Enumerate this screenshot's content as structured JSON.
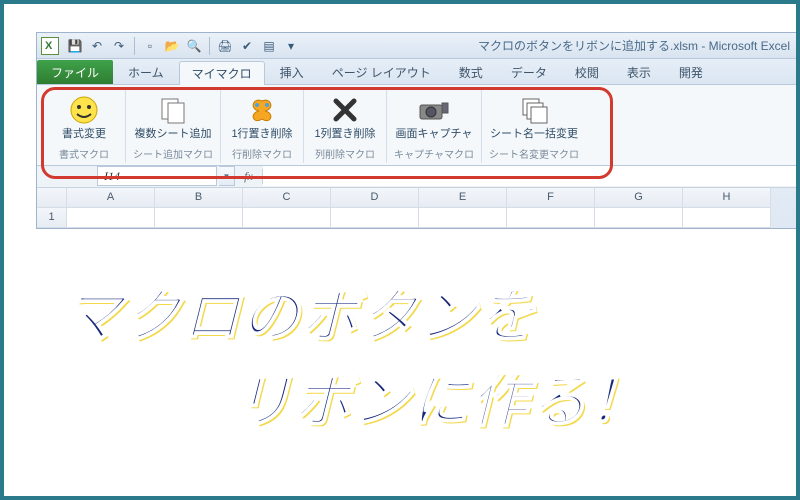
{
  "window": {
    "title": "マクロのボタンをリボンに追加する.xlsm - Microsoft Excel"
  },
  "qat_icons": [
    "save",
    "undo",
    "redo",
    "new",
    "open",
    "print-preview",
    "quick-print",
    "spelling",
    "sort",
    "filter"
  ],
  "tabs": {
    "file": "ファイル",
    "items": [
      "ホーム",
      "マイマクロ",
      "挿入",
      "ページ レイアウト",
      "数式",
      "データ",
      "校閲",
      "表示",
      "開発"
    ],
    "active_index": 1
  },
  "ribbon_groups": [
    {
      "btn_label": "書式変更",
      "group_label": "書式マクロ",
      "icon": "smile"
    },
    {
      "btn_label": "複数シート追加",
      "group_label": "シート追加マクロ",
      "icon": "copy"
    },
    {
      "btn_label": "1行置き削除",
      "group_label": "行削除マクロ",
      "icon": "butterfly"
    },
    {
      "btn_label": "1列置き削除",
      "group_label": "列削除マクロ",
      "icon": "x"
    },
    {
      "btn_label": "画面キャプチャ",
      "group_label": "キャプチャマクロ",
      "icon": "camera"
    },
    {
      "btn_label": "シート名一括変更",
      "group_label": "シート名変更マクロ",
      "icon": "stack"
    }
  ],
  "namebox": {
    "value": "I14"
  },
  "columns": [
    "A",
    "B",
    "C",
    "D",
    "E",
    "F",
    "G",
    "H"
  ],
  "row1": "1",
  "headline": {
    "line1": "マクロのボタンを",
    "line2": "リボンに作る！"
  },
  "colors": {
    "frame": "#2a7a8c",
    "highlight": "#d33a2f",
    "file_tab": "#2e7d32",
    "headline": "#17287a"
  }
}
